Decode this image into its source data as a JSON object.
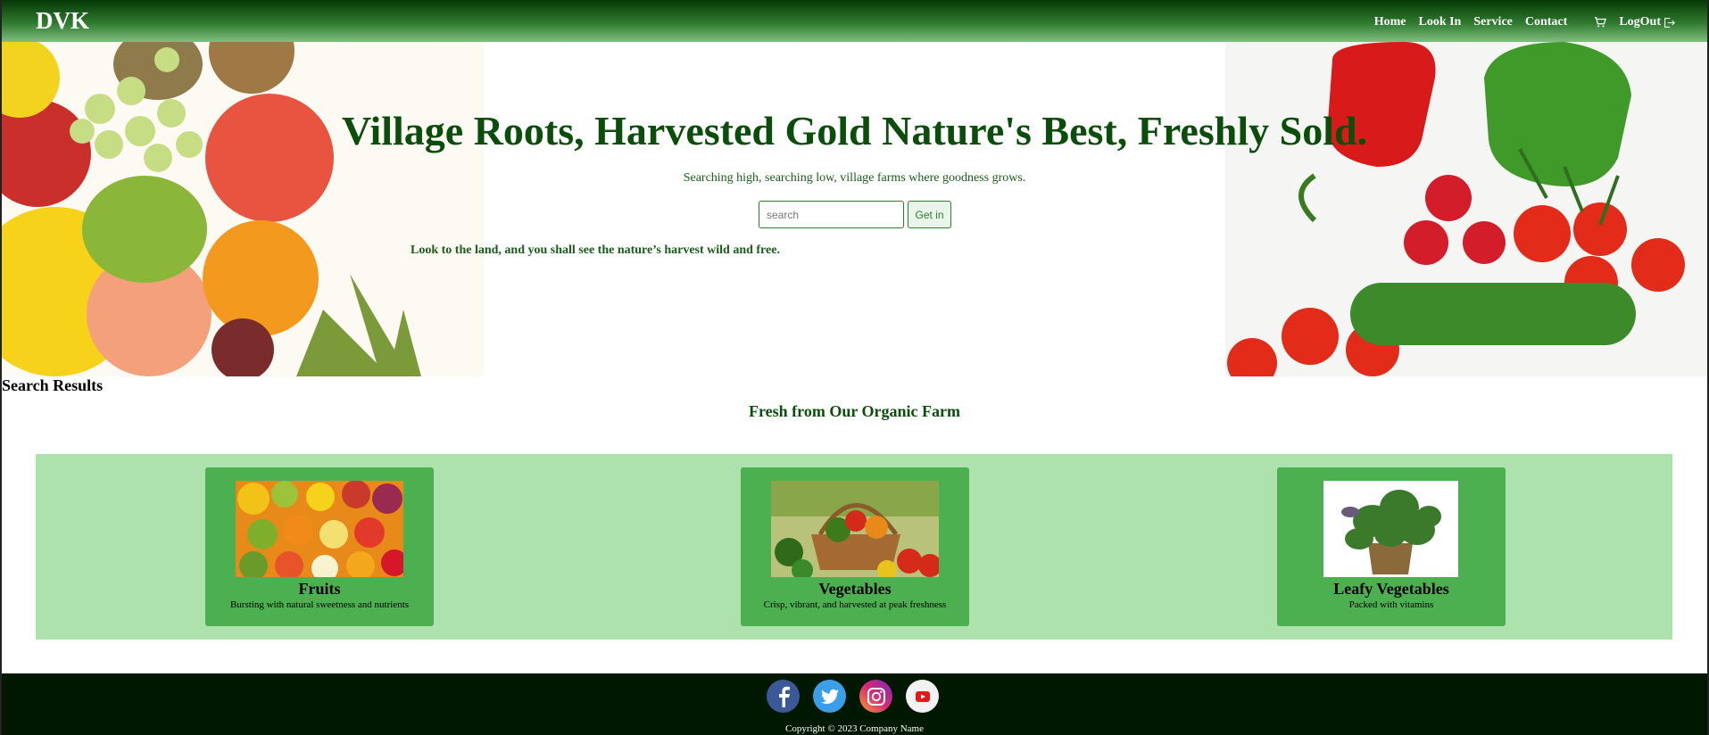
{
  "navbar": {
    "brand": "DVK",
    "links": [
      "Home",
      "Look In",
      "Service",
      "Contact"
    ],
    "cart_icon": "cart-icon",
    "logout_label": "LogOut",
    "logout_icon": "logout-icon"
  },
  "hero": {
    "title": "Village Roots, Harvested Gold Nature's Best, Freshly Sold.",
    "subtitle": "Searching high, searching low, village farms where goodness grows.",
    "search_placeholder": "search",
    "button_label": "Get in",
    "quote": "Look to the land, and you shall see the nature’s harvest wild and free."
  },
  "results": {
    "heading": "Search Results",
    "section_title": "Fresh from Our Organic Farm",
    "cards": [
      {
        "title": "Fruits",
        "desc": "Bursting with natural sweetness and nutrients"
      },
      {
        "title": "Vegetables",
        "desc": "Crisp, vibrant, and harvested at peak freshness"
      },
      {
        "title": "Leafy Vegetables",
        "desc": "Packed with vitamins"
      }
    ]
  },
  "footer": {
    "socials": [
      "facebook-icon",
      "twitter-icon",
      "instagram-icon",
      "youtube-icon"
    ],
    "copyright": "Copyright © 2023 Company Name"
  },
  "colors": {
    "nav_dark": "#063806",
    "title_green": "#0b4d0b",
    "card_green": "#4caf50",
    "band_green": "#ade2ad",
    "footer_bg": "#001800"
  }
}
